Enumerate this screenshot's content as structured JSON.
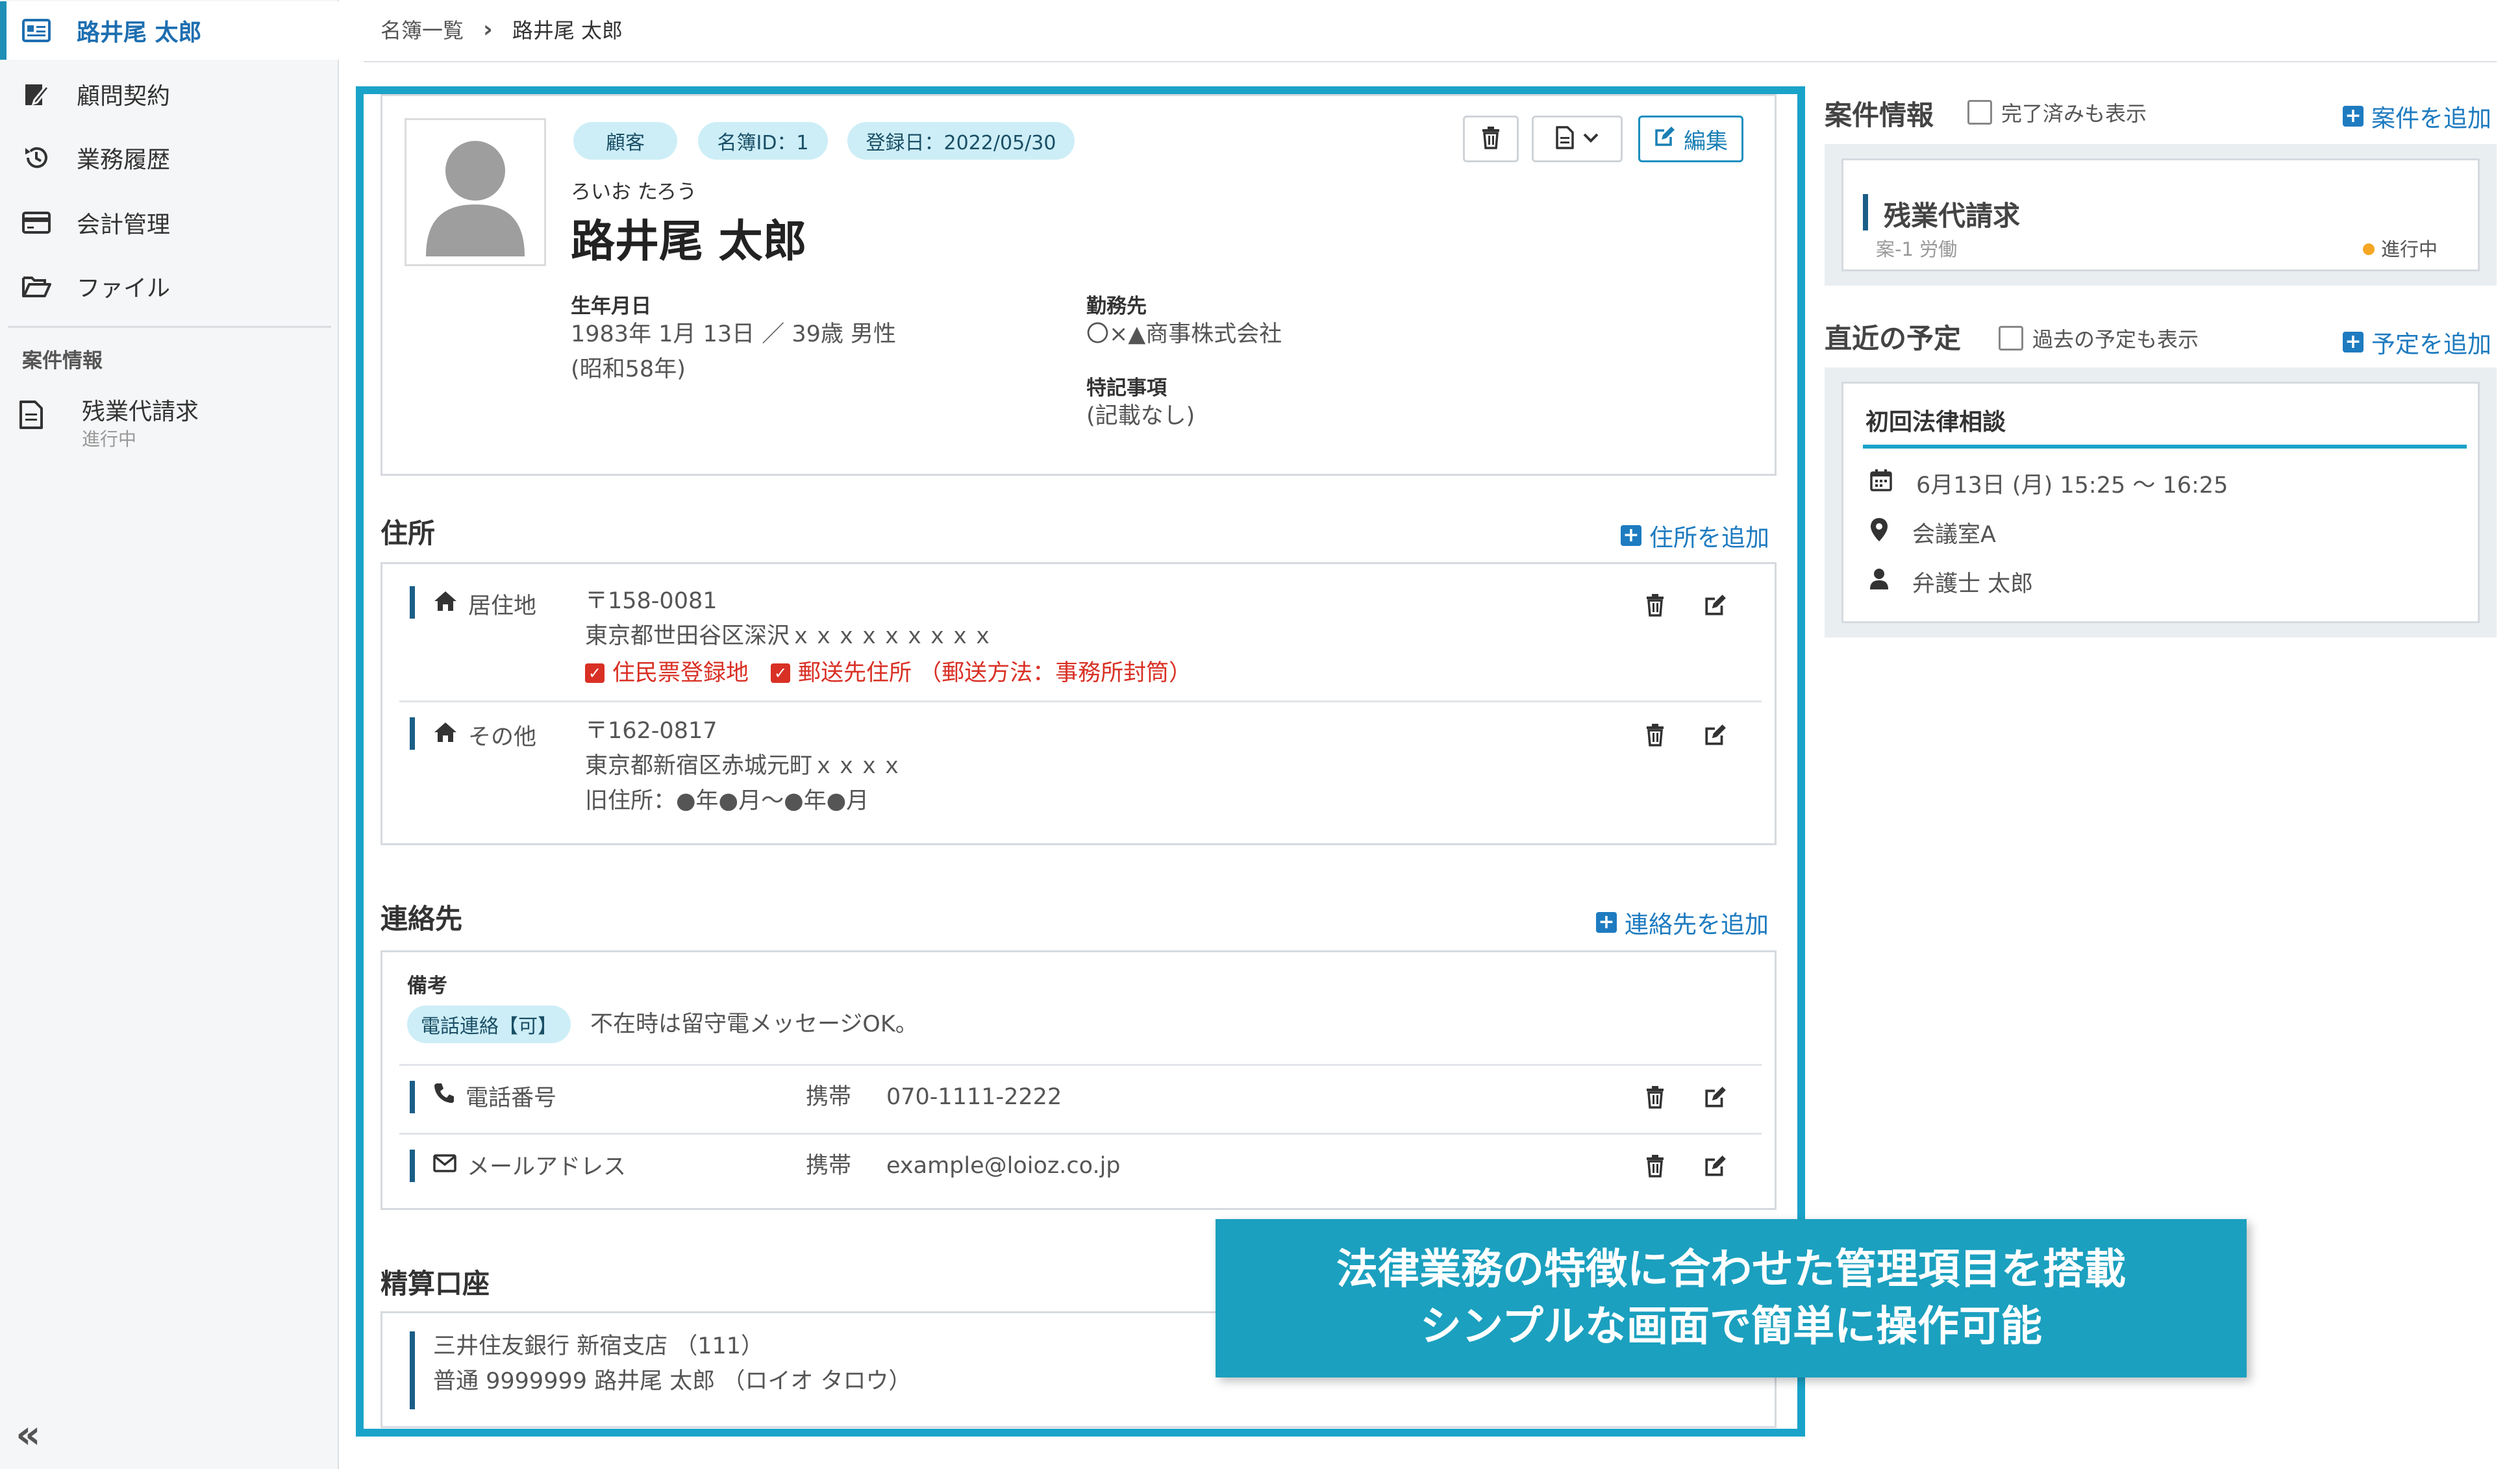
{
  "sidebar": {
    "items": [
      {
        "label": "路井尾 太郎",
        "icon": "id-card-icon",
        "active": true
      },
      {
        "label": "顧問契約",
        "icon": "contract-edit-icon"
      },
      {
        "label": "業務履歴",
        "icon": "history-icon"
      },
      {
        "label": "会計管理",
        "icon": "credit-card-icon"
      },
      {
        "label": "ファイル",
        "icon": "folder-open-icon"
      }
    ],
    "section_title": "案件情報",
    "case": {
      "title": "残業代請求",
      "status": "進行中",
      "icon": "document-icon"
    },
    "collapse_label": "«"
  },
  "breadcrumb": {
    "parent": "名簿一覧",
    "current": "路井尾 太郎"
  },
  "profile": {
    "badges": [
      "顧客",
      "名簿ID：1",
      "登録日：2022/05/30"
    ],
    "kana": "ろいお たろう",
    "name": "路井尾 太郎",
    "birth_label": "生年月日",
    "birth_line1": "1983年 1月 13日 ／ 39歳 男性",
    "birth_line2": "(昭和58年)",
    "work_label": "勤務先",
    "work_value": "〇×▲商事株式会社",
    "notes_label": "特記事項",
    "notes_value": "(記載なし)",
    "edit_label": "編集"
  },
  "address": {
    "title": "住所",
    "add_label": "住所を追加",
    "entries": [
      {
        "type": "居住地",
        "postal": "〒158-0081",
        "line": "東京都世田谷区深沢ｘｘｘｘｘｘｘｘｘ",
        "flags": [
          "住民票登録地",
          "郵送先住所 （郵送方法：事務所封筒）"
        ]
      },
      {
        "type": "その他",
        "postal": "〒162-0817",
        "line": "東京都新宿区赤城元町ｘｘｘｘ",
        "note": "旧住所：●年●月～●年●月"
      }
    ]
  },
  "contact": {
    "title": "連絡先",
    "add_label": "連絡先を追加",
    "memo_label": "備考",
    "memo_tag": "電話連絡【可】",
    "memo_text": "不在時は留守電メッセージOK。",
    "rows": [
      {
        "label": "電話番号",
        "kind": "携帯",
        "value": "070-1111-2222",
        "icon": "phone-icon"
      },
      {
        "label": "メールアドレス",
        "kind": "携帯",
        "value": "example@loioz.co.jp",
        "icon": "envelope-icon"
      }
    ]
  },
  "account": {
    "title": "精算口座",
    "line1": "三井住友銀行 新宿支店 （111）",
    "line2": "普通 9999999 路井尾 太郎 （ロイオ タロウ）"
  },
  "cases_panel": {
    "title": "案件情報",
    "checkbox_label": "完了済みも表示",
    "add_label": "案件を追加",
    "case": {
      "title": "残業代請求",
      "sub": "案-1 労働",
      "status": "進行中",
      "status_color": "#f5a623"
    }
  },
  "schedule_panel": {
    "title": "直近の予定",
    "checkbox_label": "過去の予定も表示",
    "add_label": "予定を追加",
    "event": {
      "title": "初回法律相談",
      "datetime": "6月13日 (月) 15:25 ～ 16:25",
      "place": "会議室A",
      "person": "弁護士 太郎"
    }
  },
  "callout": {
    "line1": "法律業務の特徴に合わせた管理項目を搭載",
    "line2": "シンプルな画面で簡単に操作可能"
  },
  "colors": {
    "accent": "#1aa3c9",
    "link": "#1e7bc0",
    "badge_bg": "#cdeef7",
    "danger": "#d93025"
  }
}
